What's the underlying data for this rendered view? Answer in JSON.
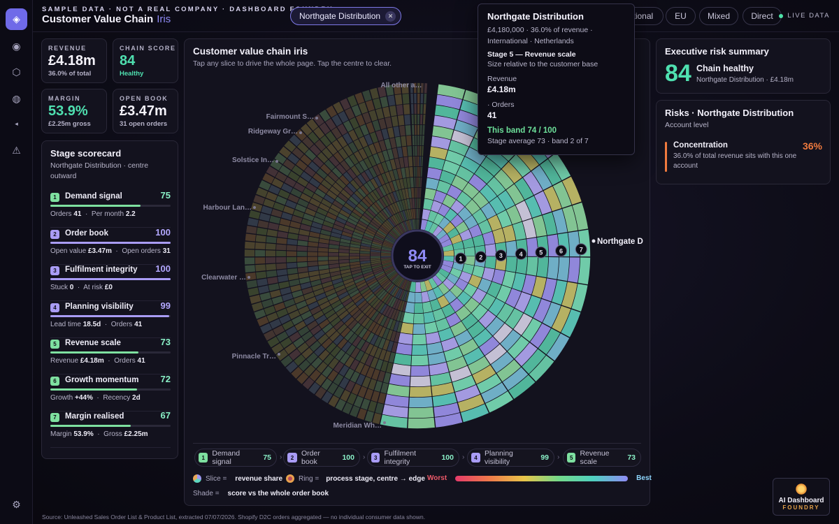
{
  "header": {
    "kicker": "SAMPLE DATA · NOT A REAL COMPANY · DASHBOARD FOUNDRY",
    "title": "Customer Value Chain",
    "title_accent": "Iris",
    "active_filter": "Northgate Distribution",
    "filters": [
      "ational",
      "EU",
      "Mixed",
      "Direct"
    ],
    "live": "LIVE DATA"
  },
  "kpis": [
    {
      "label": "REVENUE",
      "value": "£4.18m",
      "sub": "36.0% of total"
    },
    {
      "label": "CHAIN SCORE",
      "value": "84",
      "sub": "Healthy"
    },
    {
      "label": "MARGIN",
      "value": "53.9%",
      "sub": "£2.25m gross"
    },
    {
      "label": "OPEN BOOK",
      "value": "£3.47m",
      "sub": "31 open orders"
    }
  ],
  "scorecard": {
    "title": "Stage scorecard",
    "subtitle": "Northgate Distribution · centre outward",
    "stages": [
      {
        "n": "1",
        "name": "Demand signal",
        "score": "75",
        "fill": 0.75,
        "color": "#7ee0a0",
        "m1l": "Orders",
        "m1v": "41",
        "m2l": "Per month",
        "m2v": "2.2"
      },
      {
        "n": "2",
        "name": "Order book",
        "score": "100",
        "fill": 1.0,
        "color": "#a99cf5",
        "m1l": "Open value",
        "m1v": "£3.47m",
        "m2l": "Open orders",
        "m2v": "31"
      },
      {
        "n": "3",
        "name": "Fulfilment integrity",
        "score": "100",
        "fill": 1.0,
        "color": "#a99cf5",
        "m1l": "Stuck",
        "m1v": "0",
        "m2l": "At risk",
        "m2v": "£0"
      },
      {
        "n": "4",
        "name": "Planning visibility",
        "score": "99",
        "fill": 0.99,
        "color": "#a99cf5",
        "m1l": "Lead time",
        "m1v": "18.5d",
        "m2l": "Orders",
        "m2v": "41"
      },
      {
        "n": "5",
        "name": "Revenue scale",
        "score": "73",
        "fill": 0.73,
        "color": "#7ee0a0",
        "m1l": "Revenue",
        "m1v": "£4.18m",
        "m2l": "Orders",
        "m2v": "41"
      },
      {
        "n": "6",
        "name": "Growth momentum",
        "score": "72",
        "fill": 0.72,
        "color": "#7ee0a0",
        "m1l": "Growth",
        "m1v": "+44%",
        "m2l": "Recency",
        "m2v": "2d"
      },
      {
        "n": "7",
        "name": "Margin realised",
        "score": "67",
        "fill": 0.67,
        "color": "#7ee0a0",
        "m1l": "Margin",
        "m1v": "53.9%",
        "m2l": "Gross",
        "m2v": "£2.25m"
      }
    ]
  },
  "main": {
    "title": "Customer value chain iris",
    "subtitle": "Tap any slice to drive the whole page. Tap the centre to clear.",
    "centre_score": "84",
    "centre_label": "TAP TO EXIT",
    "slice_labels": [
      "All other a…",
      "Fairmount S…",
      "Ridgeway Gr…",
      "Solstice In…",
      "Harbour Lan…",
      "Clearwater …",
      "Pinnacle Tr…",
      "Meridian Wh…"
    ],
    "selected_label": "Northgate D",
    "ring_numbers": [
      "1",
      "2",
      "3",
      "4",
      "5",
      "6",
      "7"
    ],
    "legend_chips": [
      {
        "n": "1",
        "name": "Demand signal",
        "score": "75"
      },
      {
        "n": "2",
        "name": "Order book",
        "score": "100"
      },
      {
        "n": "3",
        "name": "Fulfilment integrity",
        "score": "100"
      },
      {
        "n": "4",
        "name": "Planning visibility",
        "score": "99"
      },
      {
        "n": "5",
        "name": "Revenue scale",
        "score": "73"
      }
    ],
    "key_slice_label": "Slice =",
    "key_slice_value": "revenue share",
    "key_ring_label": "Ring =",
    "key_ring_value": "process stage, centre → edge",
    "key_worst": "Worst",
    "key_best": "Best",
    "key_shade_label": "Shade =",
    "key_shade_value": "score vs the whole order book"
  },
  "tooltip": {
    "title": "Northgate Distribution",
    "line1": "£4,180,000 · 36.0% of revenue ·",
    "line2": "International · Netherlands",
    "stage": "Stage 5 — Revenue scale",
    "stage_sub": "Size relative to the customer base",
    "rev_label": "Revenue",
    "rev_value": "£4.18m",
    "orders_label": "· Orders",
    "orders_value": "41",
    "band": "This band 74 / 100",
    "band_sub": "Stage average 73 · band 2 of 7"
  },
  "exec": {
    "title": "Executive risk summary",
    "score": "84",
    "status": "Chain healthy",
    "sub": "Northgate Distribution · £4.18m"
  },
  "risks": {
    "title": "Risks · Northgate Distribution",
    "sub": "Account level",
    "item_name": "Concentration",
    "item_desc": "36.0% of total revenue sits with this one account",
    "item_value": "36%"
  },
  "footer": "Source: Unleashed Sales Order List & Product List, extracted 07/07/2026. Shopify D2C orders aggregated — no individual consumer data shown.",
  "brand": {
    "line1": "AI Dashboard",
    "line2": "FOUNDRY"
  }
}
